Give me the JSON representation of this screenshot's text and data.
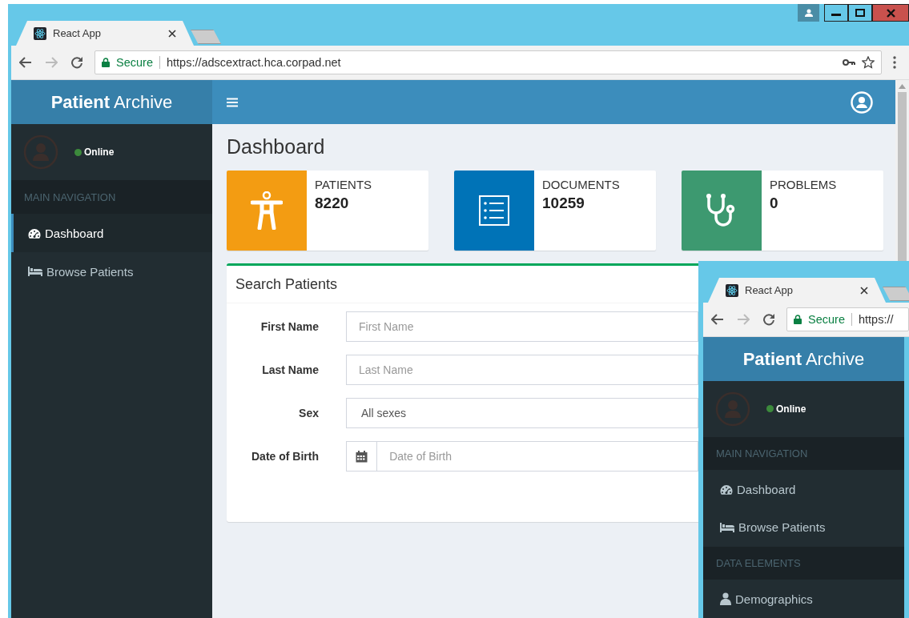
{
  "main_window": {
    "browser": {
      "tab_title": "React App",
      "address": {
        "security": "Secure",
        "url": "https://adscextract.hca.corpad.net"
      }
    },
    "app": {
      "brand": "**Patient** Archive",
      "user_status": "Online",
      "nav_sections": [
        {
          "header": "MAIN NAVIGATION",
          "items": [
            {
              "label": "Dashboard",
              "selected": true
            },
            {
              "label": "Browse Patients",
              "selected": false
            }
          ]
        }
      ],
      "page_title": "Dashboard",
      "stats": [
        {
          "label": "PATIENTS",
          "value": "8220",
          "color": "#f39c12"
        },
        {
          "label": "DOCUMENTS",
          "value": "10259",
          "color": "#0073b7"
        },
        {
          "label": "PROBLEMS",
          "value": "0",
          "color": "#3d9970"
        }
      ],
      "search": {
        "title": "Search Patients",
        "fields": [
          {
            "label": "First Name",
            "kind": "text",
            "placeholder": "First Name"
          },
          {
            "label": "Last Name",
            "kind": "text",
            "placeholder": "Last Name"
          },
          {
            "label": "Sex",
            "kind": "select",
            "value": "All sexes"
          },
          {
            "label": "Date of Birth",
            "kind": "date",
            "placeholder": "Date of Birth"
          }
        ]
      }
    }
  },
  "second_window": {
    "browser": {
      "tab_title": "React App",
      "address": {
        "security": "Secure",
        "url": "https://"
      }
    },
    "app": {
      "brand": "**Patient** Archive",
      "user_status": "Online",
      "nav_sections": [
        {
          "header": "MAIN NAVIGATION",
          "items": [
            {
              "label": "Dashboard",
              "selected": false
            },
            {
              "label": "Browse Patients",
              "selected": false
            }
          ]
        },
        {
          "header": "DATA ELEMENTS",
          "items": [
            {
              "label": "Demographics",
              "selected": false
            }
          ]
        }
      ]
    }
  }
}
